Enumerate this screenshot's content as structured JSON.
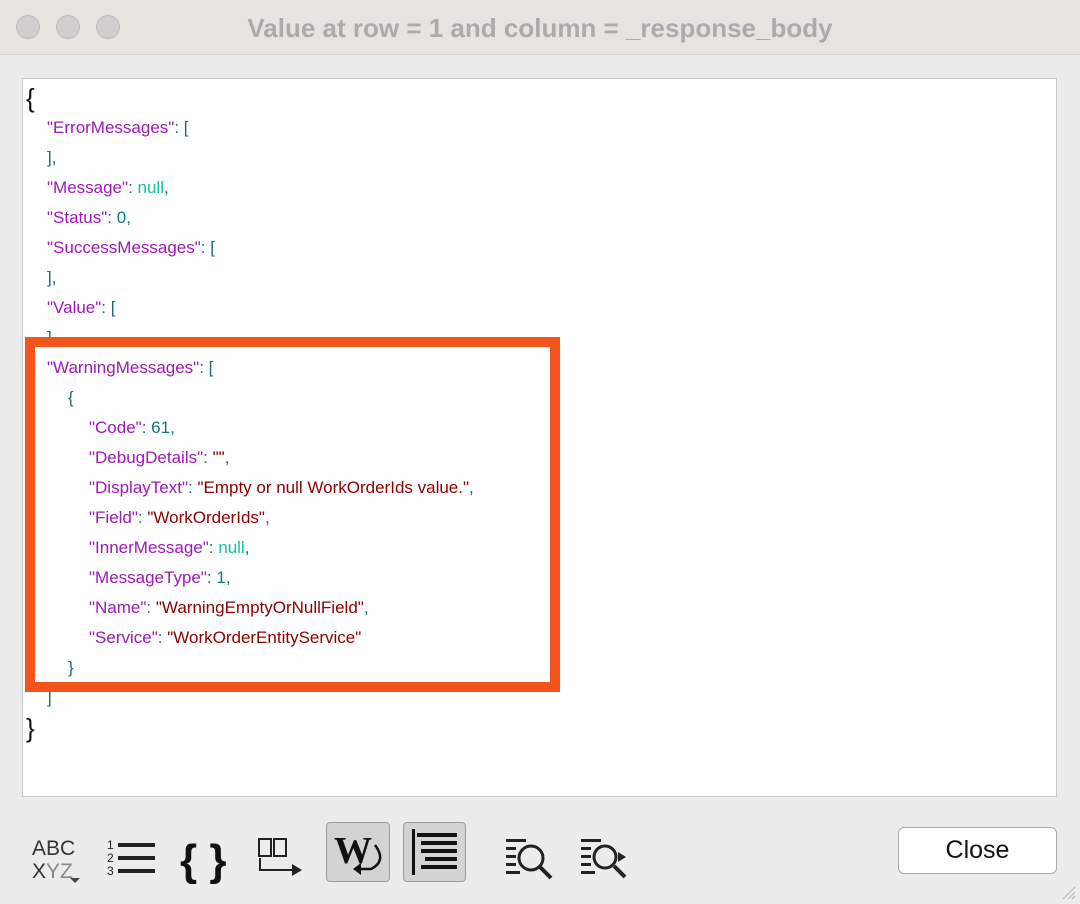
{
  "window": {
    "title": "Value at row = 1 and column = _response_body"
  },
  "json_view": {
    "lines": [
      {
        "indent": 0,
        "parts": [
          {
            "c": "brace-big",
            "t": "{"
          }
        ]
      },
      {
        "indent": 1,
        "parts": [
          {
            "c": "key",
            "t": "\"ErrorMessages\""
          },
          {
            "c": "punct",
            "t": ": ["
          }
        ]
      },
      {
        "indent": 1,
        "parts": [
          {
            "c": "punct",
            "t": "],"
          }
        ]
      },
      {
        "indent": 1,
        "parts": [
          {
            "c": "key",
            "t": "\"Message\""
          },
          {
            "c": "punct",
            "t": ": "
          },
          {
            "c": "nul",
            "t": "null"
          },
          {
            "c": "punct",
            "t": ","
          }
        ]
      },
      {
        "indent": 1,
        "parts": [
          {
            "c": "key",
            "t": "\"Status\""
          },
          {
            "c": "punct",
            "t": ": "
          },
          {
            "c": "num",
            "t": "0"
          },
          {
            "c": "punct",
            "t": ","
          }
        ]
      },
      {
        "indent": 1,
        "parts": [
          {
            "c": "key",
            "t": "\"SuccessMessages\""
          },
          {
            "c": "punct",
            "t": ": ["
          }
        ]
      },
      {
        "indent": 1,
        "parts": [
          {
            "c": "punct",
            "t": "],"
          }
        ]
      },
      {
        "indent": 1,
        "parts": [
          {
            "c": "key",
            "t": "\"Value\""
          },
          {
            "c": "punct",
            "t": ": ["
          }
        ]
      },
      {
        "indent": 1,
        "parts": [
          {
            "c": "punct",
            "t": "],"
          }
        ]
      },
      {
        "indent": 1,
        "parts": [
          {
            "c": "key",
            "t": "\"WarningMessages\""
          },
          {
            "c": "punct",
            "t": ": ["
          }
        ]
      },
      {
        "indent": 2,
        "parts": [
          {
            "c": "punct",
            "t": "{"
          }
        ]
      },
      {
        "indent": 3,
        "parts": [
          {
            "c": "key",
            "t": "\"Code\""
          },
          {
            "c": "punct",
            "t": ": "
          },
          {
            "c": "num",
            "t": "61"
          },
          {
            "c": "punct",
            "t": ","
          }
        ]
      },
      {
        "indent": 3,
        "parts": [
          {
            "c": "key",
            "t": "\"DebugDetails\""
          },
          {
            "c": "punct",
            "t": ": "
          },
          {
            "c": "str",
            "t": "\"\""
          },
          {
            "c": "punct",
            "t": ","
          }
        ]
      },
      {
        "indent": 3,
        "parts": [
          {
            "c": "key",
            "t": "\"DisplayText\""
          },
          {
            "c": "punct",
            "t": ": "
          },
          {
            "c": "str",
            "t": "\"Empty or null WorkOrderIds value.\""
          },
          {
            "c": "punct",
            "t": ","
          }
        ]
      },
      {
        "indent": 3,
        "parts": [
          {
            "c": "key",
            "t": "\"Field\""
          },
          {
            "c": "punct",
            "t": ": "
          },
          {
            "c": "str",
            "t": "\"WorkOrderIds\""
          },
          {
            "c": "punct",
            "t": ","
          }
        ]
      },
      {
        "indent": 3,
        "parts": [
          {
            "c": "key",
            "t": "\"InnerMessage\""
          },
          {
            "c": "punct",
            "t": ": "
          },
          {
            "c": "nul",
            "t": "null"
          },
          {
            "c": "punct",
            "t": ","
          }
        ]
      },
      {
        "indent": 3,
        "parts": [
          {
            "c": "key",
            "t": "\"MessageType\""
          },
          {
            "c": "punct",
            "t": ": "
          },
          {
            "c": "num",
            "t": "1"
          },
          {
            "c": "punct",
            "t": ","
          }
        ]
      },
      {
        "indent": 3,
        "parts": [
          {
            "c": "key",
            "t": "\"Name\""
          },
          {
            "c": "punct",
            "t": ": "
          },
          {
            "c": "str",
            "t": "\"WarningEmptyOrNullField\""
          },
          {
            "c": "punct",
            "t": ","
          }
        ]
      },
      {
        "indent": 3,
        "parts": [
          {
            "c": "key",
            "t": "\"Service\""
          },
          {
            "c": "punct",
            "t": ": "
          },
          {
            "c": "str",
            "t": "\"WorkOrderEntityService\""
          }
        ]
      },
      {
        "indent": 2,
        "parts": [
          {
            "c": "punct",
            "t": "}"
          }
        ]
      },
      {
        "indent": 1,
        "parts": [
          {
            "c": "punct",
            "t": "]"
          }
        ]
      },
      {
        "indent": 0,
        "parts": [
          {
            "c": "brace-big",
            "t": "}"
          }
        ]
      }
    ]
  },
  "toolbar": {
    "sort_icon": "abc-xyz-sort-icon",
    "numbered_list_icon": "numbered-list-icon",
    "braces_icon": "braces-icon",
    "braces_label": "{ }",
    "columns_icon": "columns-arrow-icon",
    "wrap_label": "W",
    "wrap_icon": "word-wrap-icon",
    "wrap_pressed": true,
    "indent_icon": "indent-lines-icon",
    "indent_pressed": true,
    "find_icon": "find-icon",
    "find_next_icon": "find-next-icon",
    "close_label": "Close"
  },
  "colors": {
    "highlight": "#f2541b",
    "key": "#9d19b8",
    "string": "#8b0000",
    "number": "#147575",
    "null": "#17c1a0"
  }
}
